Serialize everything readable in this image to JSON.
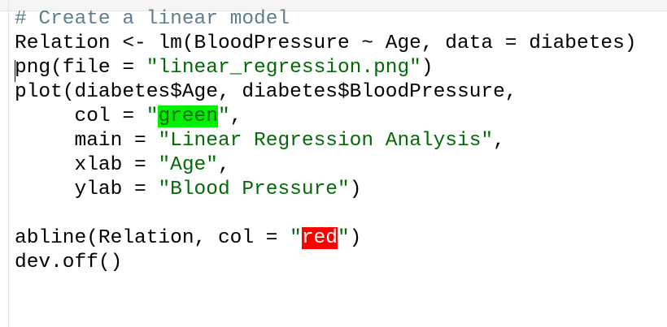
{
  "editor": {
    "lines": [
      {
        "parts": [
          {
            "t": "# Create a linear model",
            "c": "comment"
          }
        ]
      },
      {
        "parts": [
          {
            "t": "Relation <- lm(BloodPressure ~ Age, data = diabetes)",
            "c": "code"
          }
        ]
      },
      {
        "parts": [
          {
            "t": "png(file = ",
            "c": "code"
          },
          {
            "t": "\"linear_regression.png\"",
            "c": "str"
          },
          {
            "t": ")",
            "c": "code"
          }
        ]
      },
      {
        "parts": [
          {
            "t": "plot(diabetes$Age, diabetes$BloodPressure,",
            "c": "code"
          }
        ]
      },
      {
        "parts": [
          {
            "t": "     col = ",
            "c": "code"
          },
          {
            "t": "\"",
            "c": "str"
          },
          {
            "t": "green",
            "c": "hl-green"
          },
          {
            "t": "\"",
            "c": "str"
          },
          {
            "t": ",",
            "c": "code"
          }
        ]
      },
      {
        "parts": [
          {
            "t": "     main = ",
            "c": "code"
          },
          {
            "t": "\"Linear Regression Analysis\"",
            "c": "str"
          },
          {
            "t": ",",
            "c": "code"
          }
        ]
      },
      {
        "parts": [
          {
            "t": "     xlab = ",
            "c": "code"
          },
          {
            "t": "\"Age\"",
            "c": "str"
          },
          {
            "t": ",",
            "c": "code"
          }
        ]
      },
      {
        "parts": [
          {
            "t": "     ylab = ",
            "c": "code"
          },
          {
            "t": "\"Blood Pressure\"",
            "c": "str"
          },
          {
            "t": ")",
            "c": "code"
          }
        ]
      },
      {
        "parts": [
          {
            "t": "",
            "c": "code"
          }
        ]
      },
      {
        "parts": [
          {
            "t": "abline(Relation, col = ",
            "c": "code"
          },
          {
            "t": "\"",
            "c": "str"
          },
          {
            "t": "red",
            "c": "hl-red"
          },
          {
            "t": "\"",
            "c": "str"
          },
          {
            "t": ")",
            "c": "code"
          }
        ]
      },
      {
        "parts": [
          {
            "t": "dev.off()",
            "c": "code"
          }
        ]
      }
    ],
    "colors": {
      "comment": "#5f7f8f",
      "string": "#036a07",
      "keyword_text": "#000000",
      "highlight_green": "#00f000",
      "highlight_red": "#ff0000",
      "background": "#ffffff"
    }
  }
}
